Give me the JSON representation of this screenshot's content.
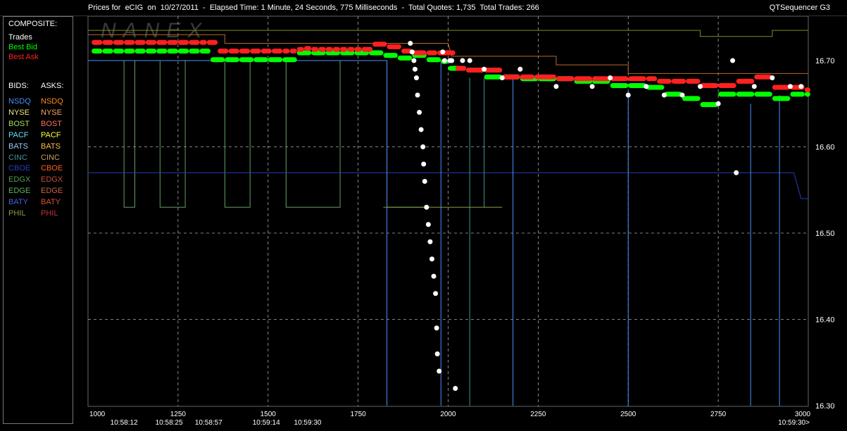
{
  "window": {
    "title": "Prices for  eCIG  on  10/27/2011  -  Elapsed Time: 1 Minute, 24 Seconds, 775 Milliseconds  -  Total Quotes: 1,735  Total Trades: 266",
    "app_name": "QTSequencer G3",
    "watermark": "NANEX"
  },
  "legend": {
    "composite_title": "COMPOSITE:",
    "composite_items": [
      {
        "label": "Trades",
        "color": "#ffffff"
      },
      {
        "label": "Best Bid",
        "color": "#00ff00"
      },
      {
        "label": "Best Ask",
        "color": "#ff2020"
      }
    ],
    "bids_title": "BIDS:",
    "asks_title": "ASKS:",
    "exchanges": [
      {
        "bid": "NSDQ",
        "ask": "NSDQ",
        "bid_color": "#4a90ff",
        "ask_color": "#ff8c1a"
      },
      {
        "bid": "NYSE",
        "ask": "NYSE",
        "bid_color": "#e8e878",
        "ask_color": "#ffa060"
      },
      {
        "bid": "BOST",
        "ask": "BOST",
        "bid_color": "#a0e060",
        "ask_color": "#ff7060"
      },
      {
        "bid": "PACF",
        "ask": "PACF",
        "bid_color": "#60e0ff",
        "ask_color": "#ffff40"
      },
      {
        "bid": "BATS",
        "ask": "BATS",
        "bid_color": "#a0c8ff",
        "ask_color": "#ffc040"
      },
      {
        "bid": "CINC",
        "ask": "CINC",
        "bid_color": "#4a9090",
        "ask_color": "#c0a060"
      },
      {
        "bid": "CBOE",
        "ask": "CBOE",
        "bid_color": "#2040c0",
        "ask_color": "#ff6020"
      },
      {
        "bid": "EDGX",
        "ask": "EDGX",
        "bid_color": "#50a050",
        "ask_color": "#c05040"
      },
      {
        "bid": "EDGE",
        "ask": "EDGE",
        "bid_color": "#60b060",
        "ask_color": "#d06040"
      },
      {
        "bid": "BATY",
        "ask": "BATY",
        "bid_color": "#4060e0",
        "ask_color": "#e05030"
      },
      {
        "bid": "PHIL",
        "ask": "PHIL",
        "bid_color": "#80a040",
        "ask_color": "#c03040"
      }
    ]
  },
  "chart_data": {
    "type": "scatter",
    "x_axis": {
      "range": [
        1000,
        3000
      ],
      "tick_labels": [
        "1000",
        "1250",
        "1500",
        "1750",
        "2000",
        "2250",
        "2500",
        "2750",
        "3000"
      ],
      "time_labels": [
        {
          "x": 1100,
          "label": "10:58:12"
        },
        {
          "x": 1225,
          "label": "10:58:25"
        },
        {
          "x": 1335,
          "label": "10:58:57"
        },
        {
          "x": 1495,
          "label": "10:59:14"
        },
        {
          "x": 1610,
          "label": "10:59:30"
        },
        {
          "x": 2960,
          "label": "10:59:30>"
        }
      ],
      "grid": true
    },
    "y_axis": {
      "range": [
        16.3,
        16.74
      ],
      "tick_labels": [
        "16.70",
        "16.60",
        "16.50",
        "16.40",
        "16.30"
      ],
      "tick_values": [
        16.7,
        16.6,
        16.5,
        16.4,
        16.3
      ],
      "grid": true,
      "position": "right"
    },
    "series": [
      {
        "name": "Best Ask",
        "color": "#ff2020",
        "x": [
          1010,
          1040,
          1070,
          1100,
          1130,
          1160,
          1190,
          1220,
          1250,
          1280,
          1310,
          1330,
          1360,
          1390,
          1420,
          1450,
          1480,
          1510,
          1540,
          1560,
          1580,
          1600,
          1620,
          1640,
          1660,
          1680,
          1700,
          1720,
          1740,
          1760,
          1790,
          1830,
          1870,
          1900,
          1940,
          1970,
          2020,
          2050,
          2100,
          2150,
          2200,
          2240,
          2300,
          2350,
          2400,
          2450,
          2500,
          2550,
          2580,
          2620,
          2660,
          2700,
          2750,
          2800,
          2850,
          2900,
          2950,
          2990
        ],
        "y": [
          16.721,
          16.721,
          16.721,
          16.721,
          16.721,
          16.721,
          16.721,
          16.721,
          16.721,
          16.721,
          16.721,
          16.721,
          16.711,
          16.711,
          16.711,
          16.711,
          16.711,
          16.711,
          16.711,
          16.711,
          16.713,
          16.714,
          16.713,
          16.713,
          16.713,
          16.713,
          16.713,
          16.713,
          16.713,
          16.713,
          16.719,
          16.716,
          16.711,
          16.709,
          16.709,
          16.709,
          16.691,
          16.689,
          16.689,
          16.681,
          16.681,
          16.681,
          16.679,
          16.679,
          16.679,
          16.679,
          16.679,
          16.679,
          16.676,
          16.676,
          16.676,
          16.671,
          16.671,
          16.676,
          16.681,
          16.669,
          16.669,
          16.666
        ]
      },
      {
        "name": "Best Bid",
        "color": "#00ff00",
        "x": [
          1010,
          1040,
          1070,
          1100,
          1130,
          1160,
          1190,
          1220,
          1250,
          1280,
          1310,
          1340,
          1380,
          1420,
          1460,
          1500,
          1540,
          1580,
          1620,
          1660,
          1700,
          1740,
          1780,
          1820,
          1860,
          1900,
          1940,
          1980,
          2000,
          2050,
          2100,
          2150,
          2200,
          2250,
          2300,
          2350,
          2400,
          2450,
          2500,
          2550,
          2600,
          2650,
          2700,
          2750,
          2800,
          2850,
          2900,
          2950,
          2990
        ],
        "y": [
          16.711,
          16.711,
          16.711,
          16.711,
          16.711,
          16.711,
          16.711,
          16.711,
          16.711,
          16.711,
          16.711,
          16.701,
          16.701,
          16.701,
          16.701,
          16.701,
          16.701,
          16.709,
          16.709,
          16.709,
          16.709,
          16.709,
          16.709,
          16.706,
          16.703,
          16.706,
          16.701,
          16.699,
          16.691,
          16.689,
          16.681,
          16.681,
          16.679,
          16.679,
          16.679,
          16.676,
          16.676,
          16.671,
          16.671,
          16.669,
          16.661,
          16.656,
          16.649,
          16.661,
          16.661,
          16.661,
          16.656,
          16.661,
          16.661
        ]
      },
      {
        "name": "Trades",
        "color": "#ffffff",
        "x": [
          1895,
          1900,
          1905,
          1908,
          1912,
          1915,
          1920,
          1925,
          1930,
          1932,
          1935,
          1940,
          1945,
          1950,
          1955,
          1960,
          1965,
          1968,
          1970,
          1975,
          1985,
          1990,
          2005,
          2010,
          2020,
          2040,
          2060,
          2100,
          2150,
          2200,
          2300,
          2400,
          2450,
          2500,
          2550,
          2600,
          2650,
          2700,
          2750,
          2790,
          2800,
          2850,
          2900,
          2950,
          2980
        ],
        "y": [
          16.72,
          16.71,
          16.7,
          16.69,
          16.68,
          16.66,
          16.64,
          16.62,
          16.6,
          16.58,
          16.56,
          16.53,
          16.51,
          16.49,
          16.47,
          16.45,
          16.43,
          16.39,
          16.36,
          16.34,
          16.71,
          16.7,
          16.7,
          16.7,
          16.32,
          16.7,
          16.7,
          16.69,
          16.68,
          16.69,
          16.67,
          16.67,
          16.68,
          16.66,
          16.67,
          16.66,
          16.66,
          16.67,
          16.65,
          16.7,
          16.57,
          16.67,
          16.68,
          16.67,
          16.67
        ]
      }
    ]
  }
}
